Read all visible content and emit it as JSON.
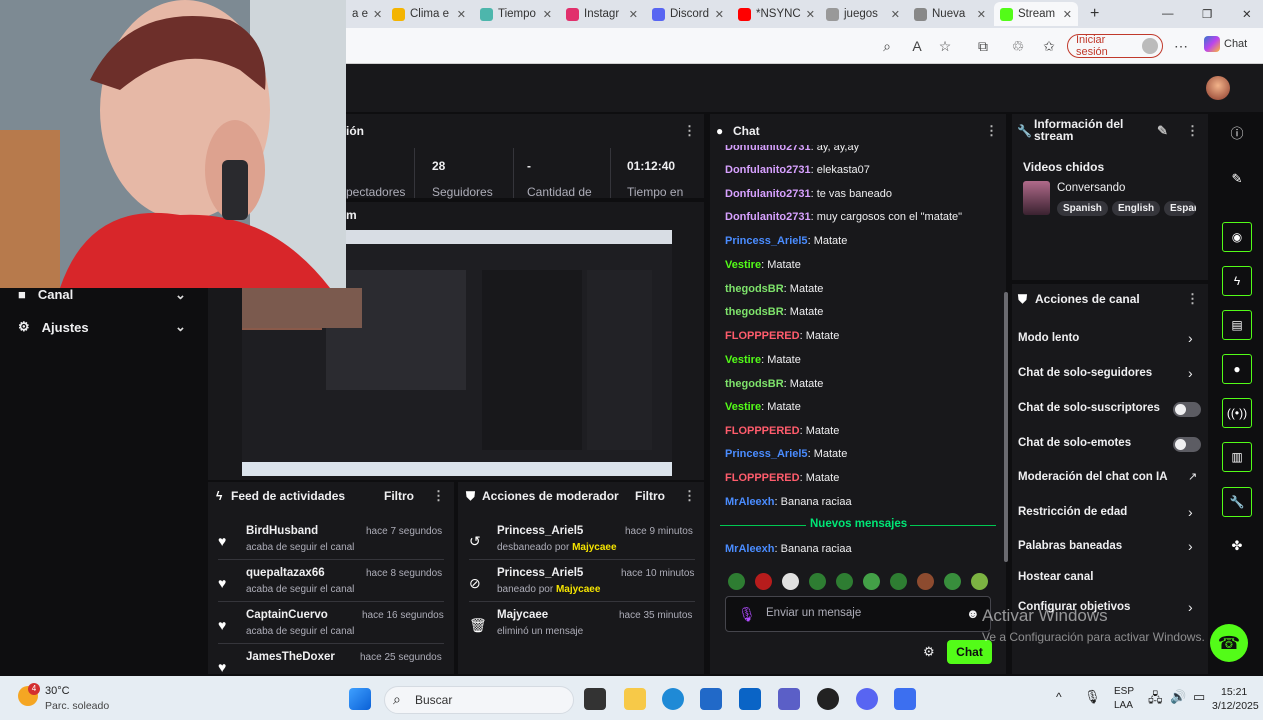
{
  "browser": {
    "tabs": [
      {
        "label": "a e",
        "color": "#6b7280"
      },
      {
        "label": "Clima e",
        "color": "#f4b400"
      },
      {
        "label": "Tiempo",
        "color": "#4db6ac"
      },
      {
        "label": "Instagr",
        "color": "#e1306c"
      },
      {
        "label": "Discord",
        "color": "#5865f2"
      },
      {
        "label": "*NSYNC",
        "color": "#ff0000"
      },
      {
        "label": "juegos",
        "color": "#888888"
      },
      {
        "label": "Nueva",
        "color": "#777777"
      },
      {
        "label": "Stream",
        "color": "#53fc18"
      }
    ],
    "signin_label": "Iniciar sesión",
    "copilot_label": "Chat"
  },
  "dashboard": {
    "session_title": "ión",
    "stats": [
      {
        "value": "",
        "label": "pectadores"
      },
      {
        "value": "28",
        "label": "Seguidores"
      },
      {
        "value": "-",
        "label": "Cantidad de"
      },
      {
        "value": "01:12:40",
        "label": "Tiempo en"
      }
    ],
    "stream_label": "m",
    "sidebar": [
      {
        "label": "Canal"
      },
      {
        "label": "Ajustes"
      }
    ]
  },
  "feed": {
    "title": "Feed de actividades",
    "filter_label": "Filtro",
    "items": [
      {
        "name": "BirdHusband",
        "sub": "acaba de seguir el canal",
        "time": "hace 7 segundos"
      },
      {
        "name": "quepaltazax66",
        "sub": "acaba de seguir el canal",
        "time": "hace 8 segundos"
      },
      {
        "name": "CaptainCuervo",
        "sub": "acaba de seguir el canal",
        "time": "hace 16 segundos"
      },
      {
        "name": "JamesTheDoxer",
        "sub": "",
        "time": "hace 25 segundos"
      }
    ]
  },
  "moderator": {
    "title": "Acciones de moderador",
    "filter_label": "Filtro",
    "items": [
      {
        "name": "Princess_Ariel5",
        "action": "desbaneado por",
        "by": "Majycaee",
        "time": "hace 9 minutos",
        "icon": "undo-icon"
      },
      {
        "name": "Princess_Ariel5",
        "action": "baneado por",
        "by": "Majycaee",
        "time": "hace 10 minutos",
        "icon": "ban-icon"
      },
      {
        "name": "Majycaee",
        "action": "eliminó un mensaje",
        "by": "",
        "time": "hace 35 minutos",
        "icon": "trash-icon"
      }
    ]
  },
  "chat": {
    "title": "Chat",
    "messages": [
      {
        "user": "Donfulanito2731",
        "text": "ay, ay,ay",
        "color": "#d7a1ff"
      },
      {
        "user": "Donfulanito2731",
        "text": "elekasta07",
        "color": "#d7a1ff"
      },
      {
        "user": "Donfulanito2731",
        "text": "te vas baneado",
        "color": "#d7a1ff"
      },
      {
        "user": "Donfulanito2731",
        "text": "muy cargosos con el \"matate\"",
        "color": "#d7a1ff"
      },
      {
        "user": "Princess_Ariel5",
        "text": "Matate",
        "color": "#4a8cff"
      },
      {
        "user": "Vestire",
        "text": "Matate",
        "color": "#53fc18"
      },
      {
        "user": "thegodsBR",
        "text": "Matate",
        "color": "#7ee36b"
      },
      {
        "user": "thegodsBR",
        "text": "Matate",
        "color": "#7ee36b"
      },
      {
        "user": "FLOPPPERED",
        "text": "Matate",
        "color": "#ff5c6c"
      },
      {
        "user": "Vestire",
        "text": "Matate",
        "color": "#53fc18"
      },
      {
        "user": "thegodsBR",
        "text": "Matate",
        "color": "#7ee36b"
      },
      {
        "user": "Vestire",
        "text": "Matate",
        "color": "#53fc18"
      },
      {
        "user": "FLOPPPERED",
        "text": "Matate",
        "color": "#ff5c6c"
      },
      {
        "user": "Princess_Ariel5",
        "text": "Matate",
        "color": "#4a8cff"
      },
      {
        "user": "FLOPPPERED",
        "text": "Matate",
        "color": "#ff5c6c"
      },
      {
        "user": "MrAleexh",
        "text": "Banana raciaa",
        "color": "#4a8cff"
      }
    ],
    "new_messages_label": "Nuevos mensajes",
    "after": [
      {
        "user": "MrAleexh",
        "text": "Banana raciaa",
        "color": "#4a8cff"
      }
    ],
    "input_placeholder": "Enviar un mensaje",
    "send_label": "Chat"
  },
  "stream_info": {
    "title": "Información del stream",
    "stream_name": "Videos chidos",
    "category": "Conversando",
    "tags": [
      "Spanish",
      "English",
      "Espar"
    ]
  },
  "channel_actions": {
    "title": "Acciones de canal",
    "items": [
      {
        "label": "Modo lento",
        "control": "chevron"
      },
      {
        "label": "Chat de solo-seguidores",
        "control": "chevron"
      },
      {
        "label": "Chat de solo-suscriptores",
        "control": "toggle"
      },
      {
        "label": "Chat de solo-emotes",
        "control": "toggle"
      },
      {
        "label": "Moderación del chat con IA",
        "control": "external"
      },
      {
        "label": "Restricción de edad",
        "control": "chevron"
      },
      {
        "label": "Palabras baneadas",
        "control": "chevron"
      },
      {
        "label": "Hostear canal",
        "control": "none"
      },
      {
        "label": "Configurar objetivos",
        "control": "chevron"
      }
    ]
  },
  "watermark": {
    "line1": "Activar Windows",
    "line2": "Ve a Configuración para activar Windows."
  },
  "taskbar": {
    "weather_temp": "30°C",
    "weather_desc": "Parc. soleado",
    "weather_badge": "4",
    "search_label": "Buscar",
    "lang1": "ESP",
    "lang2": "LAA",
    "time": "15:21",
    "date": "3/12/2025"
  }
}
